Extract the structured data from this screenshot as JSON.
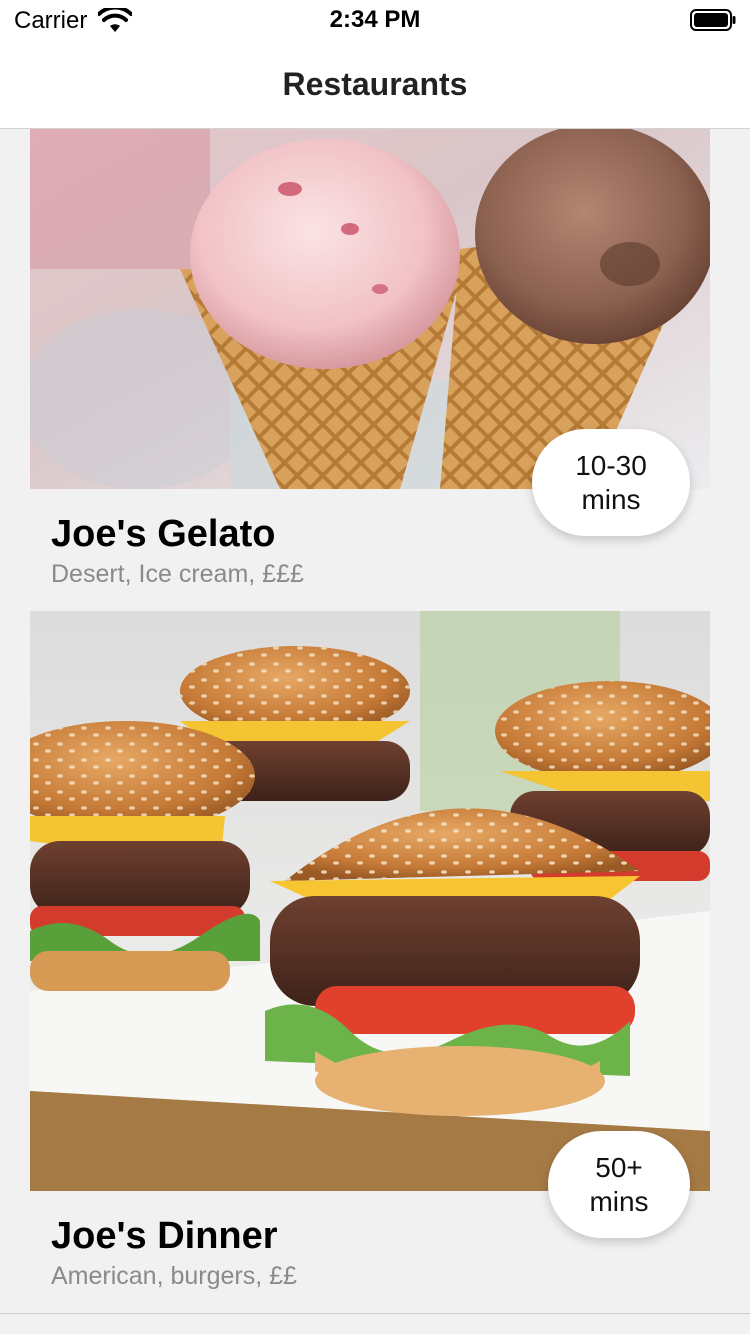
{
  "status_bar": {
    "carrier": "Carrier",
    "time": "2:34 PM",
    "icons": [
      "wifi-icon",
      "battery-icon"
    ]
  },
  "nav": {
    "title": "Restaurants"
  },
  "restaurants": [
    {
      "name": "Joe's Gelato",
      "tags": "Desert, Ice cream, £££",
      "time_line1": "10-30",
      "time_line2": "mins"
    },
    {
      "name": "Joe's Dinner",
      "tags": "American, burgers, ££",
      "time_line1": "50+",
      "time_line2": "mins"
    }
  ],
  "colors": {
    "background": "#f1f1f1",
    "subtitle": "#8a8a8a",
    "badge": "#ffffff"
  }
}
